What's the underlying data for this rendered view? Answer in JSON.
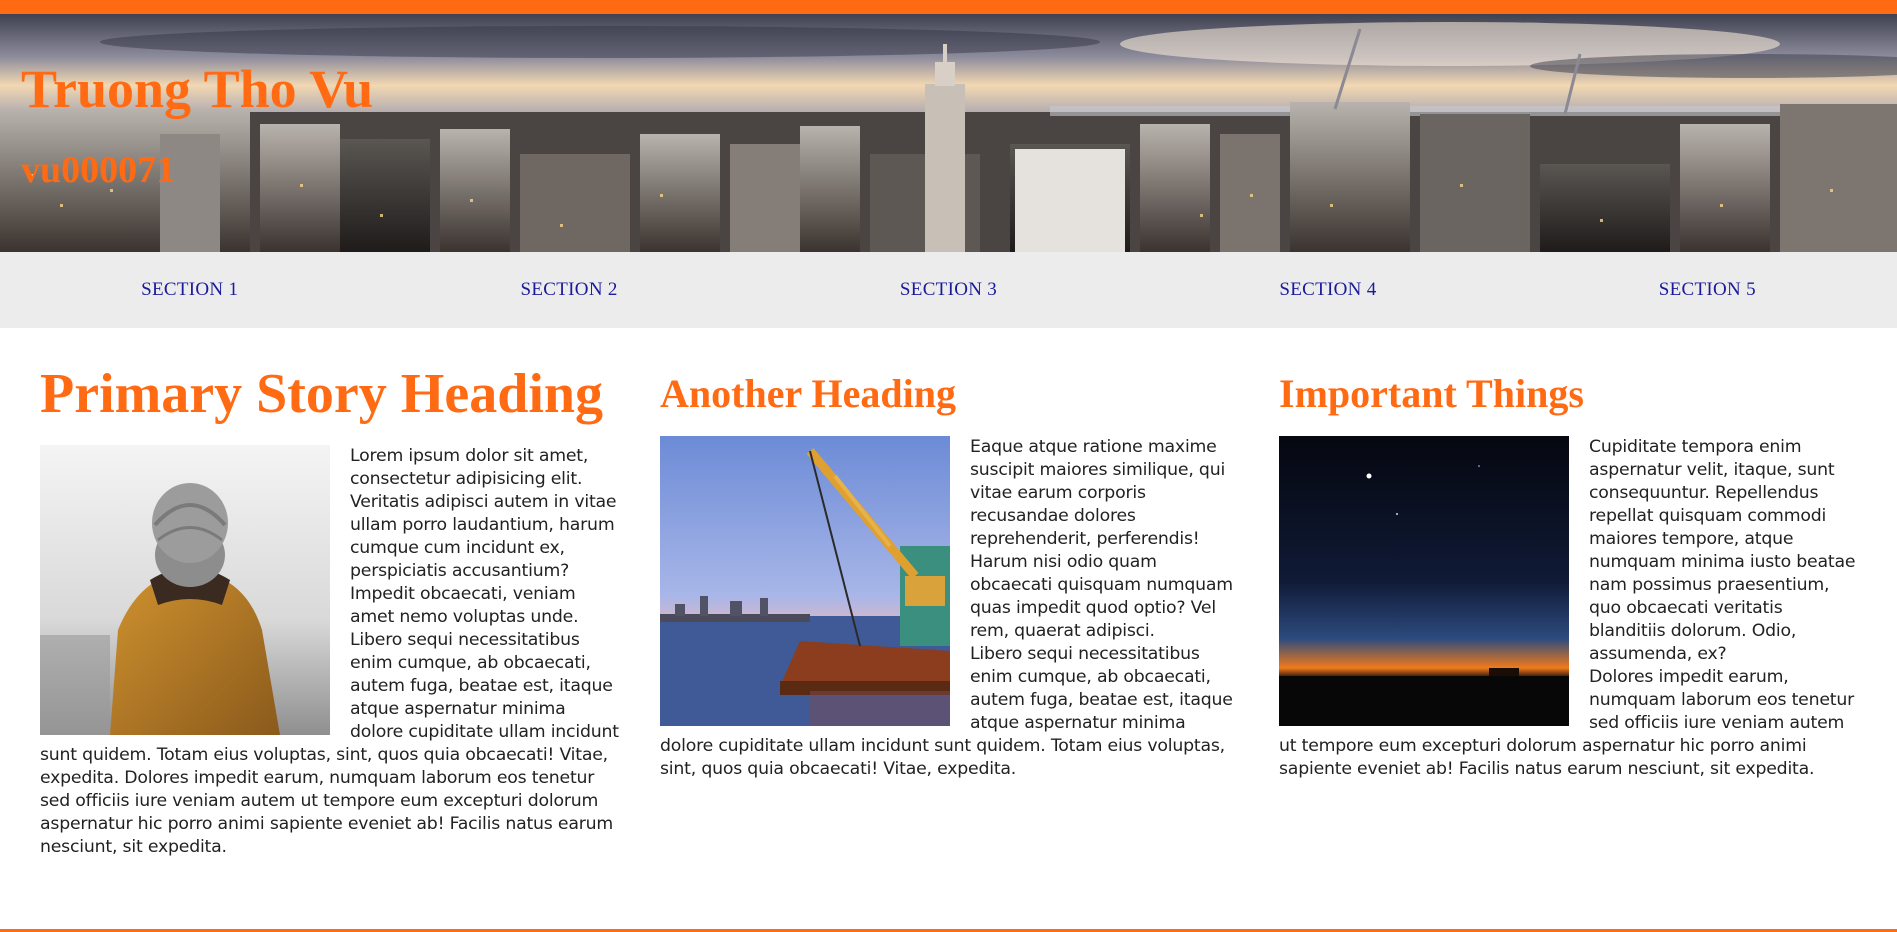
{
  "header": {
    "title": "Truong Tho Vu",
    "subtitle": "vu000071"
  },
  "colors": {
    "accent": "#ff6a13",
    "nav_link": "#1a1a9a",
    "nav_bg": "#ececec",
    "text": "#222222"
  },
  "nav": {
    "items": [
      {
        "label": "SECTION 1"
      },
      {
        "label": "SECTION 2"
      },
      {
        "label": "SECTION 3"
      },
      {
        "label": "SECTION 4"
      },
      {
        "label": "SECTION 5"
      }
    ]
  },
  "columns": [
    {
      "heading": "Primary Story Heading",
      "image": "person-in-beanie-photo",
      "paragraphs": [
        "Lorem ipsum dolor sit amet, consectetur adipisicing elit. Veritatis adipisci autem in vitae ullam porro laudantium, harum cumque cum incidunt ex, perspiciatis accusantium? Impedit obcaecati, veniam amet nemo voluptas unde.",
        "Libero sequi necessitatibus enim cumque, ab obcaecati, autem fuga, beatae est, itaque atque aspernatur minima dolore cupiditate ullam incidunt sunt quidem. Totam eius voluptas, sint, quos quia obcaecati! Vitae, expedita. Dolores impedit earum, numquam laborum eos tenetur sed officiis iure veniam autem ut tempore eum excepturi dolorum aspernatur hic porro animi sapiente eveniet ab! Facilis natus earum nesciunt, sit expedita."
      ]
    },
    {
      "heading": "Another Heading",
      "image": "harbor-crane-photo",
      "paragraphs": [
        "Eaque atque ratione maxime suscipit maiores similique, qui vitae earum corporis recusandae dolores reprehenderit, perferendis! Harum nisi odio quam obcaecati quisquam numquam quas impedit quod optio? Vel rem, quaerat adipisci.",
        "Libero sequi necessitatibus enim cumque, ab obcaecati, autem fuga, beatae est, itaque atque aspernatur minima dolore cupiditate ullam incidunt sunt quidem. Totam eius voluptas, sint, quos quia obcaecati! Vitae, expedita."
      ]
    },
    {
      "heading": "Important Things",
      "image": "night-sky-horizon-photo",
      "paragraphs": [
        "Cupiditate tempora enim aspernatur velit, itaque, sunt consequuntur. Repellendus repellat quisquam commodi maiores tempore, atque numquam minima iusto beatae nam possimus praesentium, quo obcaecati veritatis blanditiis dolorum. Odio, assumenda, ex?",
        "Dolores impedit earum, numquam laborum eos tenetur sed officiis iure veniam autem ut tempore eum excepturi dolorum aspernatur hic porro animi sapiente eveniet ab! Facilis natus earum nesciunt, sit expedita."
      ]
    }
  ]
}
